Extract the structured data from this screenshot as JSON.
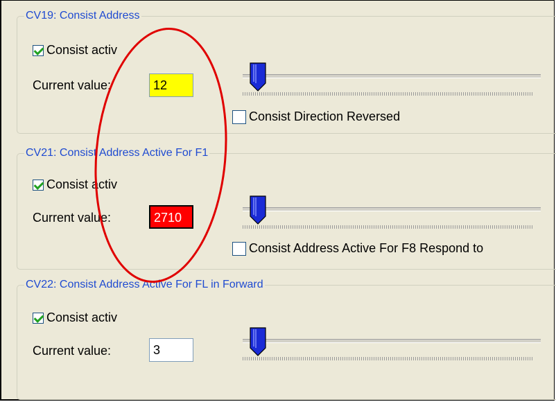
{
  "groups": [
    {
      "title": "CV19: Consist Address",
      "consist_label": "Consist activ",
      "consist_checked": true,
      "current_label": "Current value:",
      "value": "12",
      "value_color": "#ffff00",
      "slider_level": 0.0,
      "extra_checkbox_label": "Consist Direction Reversed",
      "extra_checkbox_checked": false
    },
    {
      "title": "CV21: Consist Address Active For F1",
      "consist_label": "Consist activ",
      "consist_checked": true,
      "current_label": "Current value:",
      "value": "2710",
      "value_color": "#ff0000",
      "slider_level": 0.0,
      "extra_checkbox_label": "Consist Address Active For F8 Respond to",
      "extra_checkbox_checked": false
    },
    {
      "title": "CV22: Consist Address Active For FL in Forward",
      "consist_label": "Consist activ",
      "consist_checked": true,
      "current_label": "Current value:",
      "value": "3",
      "value_color": "#ffffff",
      "slider_level": 0.0
    }
  ],
  "colors": {
    "group_title": "#1f4bd1",
    "panel_bg": "#ece9d8",
    "slider_thumb": "#1a2bd6",
    "annotation_ellipse": "#e00000"
  }
}
